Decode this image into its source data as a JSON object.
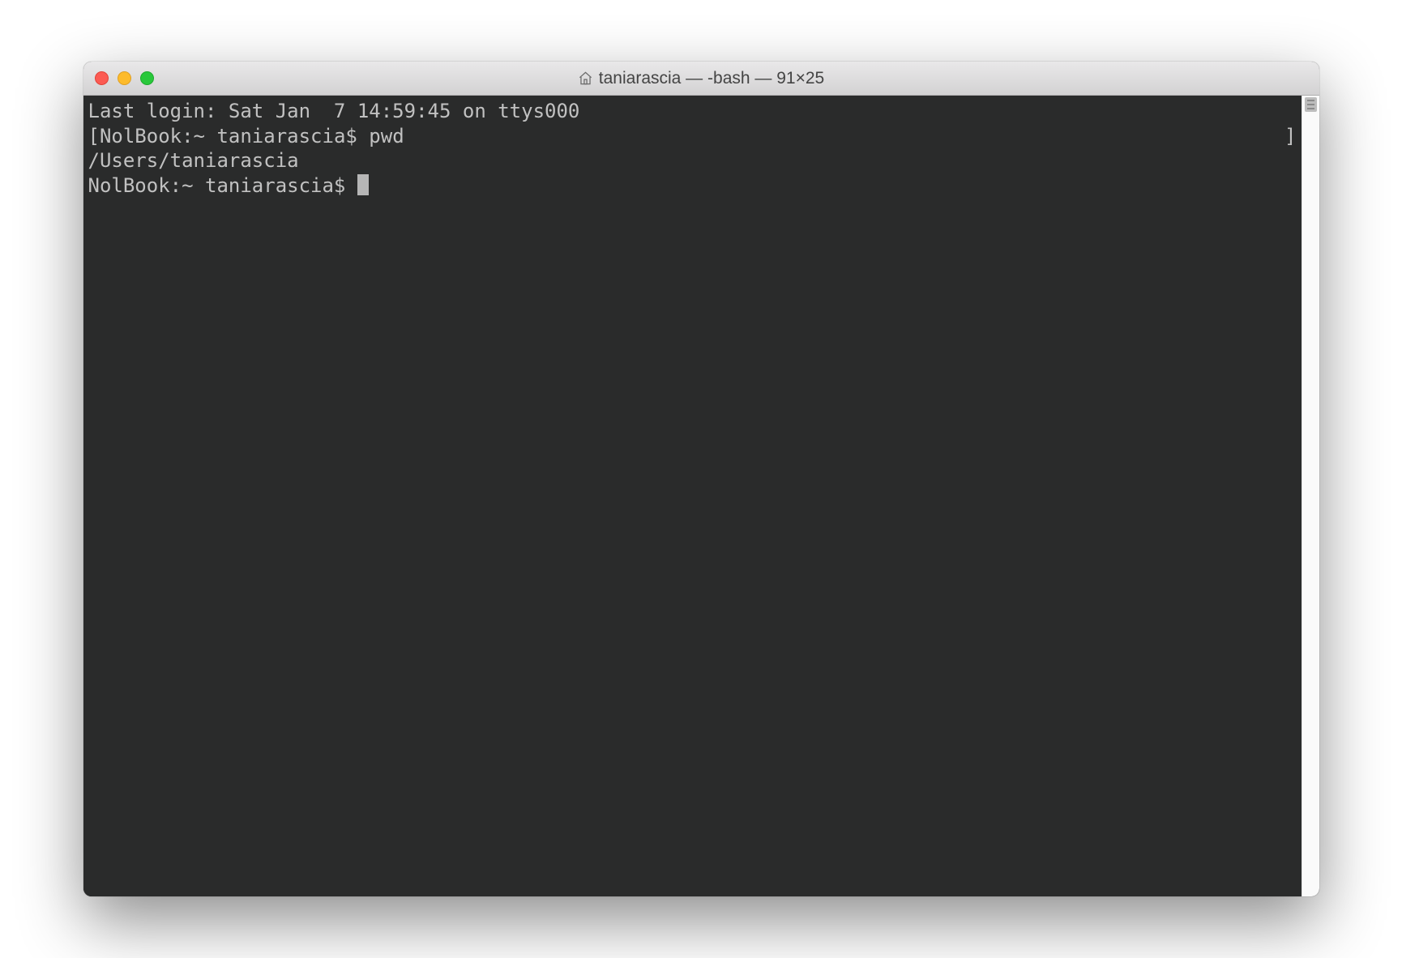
{
  "window": {
    "title": "taniarascia — -bash — 91×25",
    "icon": "home-icon"
  },
  "terminal": {
    "last_login_line": "Last login: Sat Jan  7 14:59:45 on ttys000",
    "prompt_left_bracket": "[",
    "prompt_right_bracket": "]",
    "prompt_1": "NolBook:~ taniarascia$ ",
    "command_1": "pwd",
    "output_1": "/Users/taniarascia",
    "prompt_2": "NolBook:~ taniarascia$ "
  },
  "colors": {
    "terminal_bg": "#2a2b2b",
    "terminal_fg": "#c1c1c1",
    "titlebar_top": "#e9e8e9",
    "titlebar_bottom": "#d3d2d3",
    "close": "#fc5b53",
    "minimize": "#fdbb2b",
    "zoom": "#29c83b"
  }
}
